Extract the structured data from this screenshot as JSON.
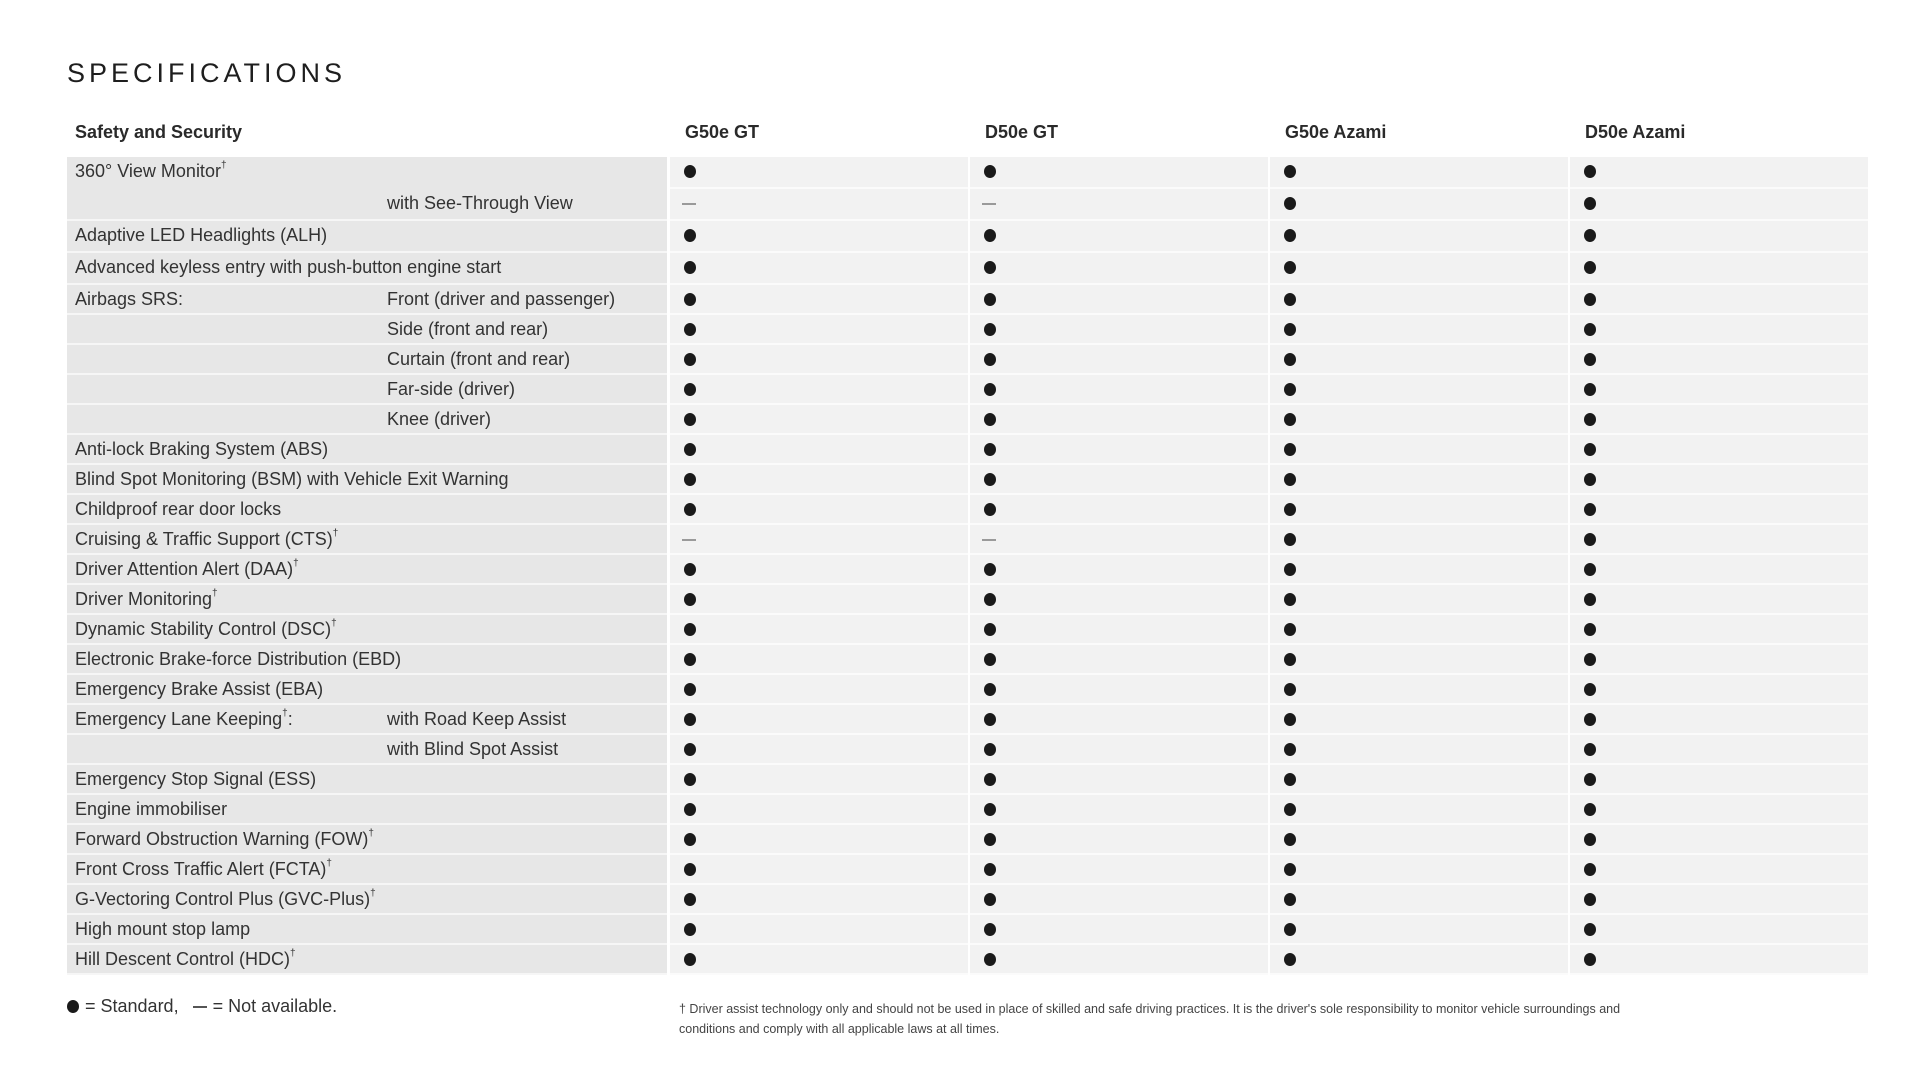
{
  "page": {
    "title": "SPECIFICATIONS"
  },
  "table": {
    "section_header": "Safety and Security",
    "columns": [
      "G50e GT",
      "D50e GT",
      "G50e Azami",
      "D50e Azami"
    ],
    "rows": [
      {
        "label": "360° View Monitor",
        "dagger": true,
        "sub": "",
        "values": [
          "standard",
          "standard",
          "standard",
          "standard"
        ]
      },
      {
        "label": "",
        "dagger": false,
        "sub": "with See-Through View",
        "values": [
          "not_available",
          "not_available",
          "standard",
          "standard"
        ]
      },
      {
        "label": "Adaptive LED Headlights (ALH)",
        "dagger": false,
        "sub": "",
        "values": [
          "standard",
          "standard",
          "standard",
          "standard"
        ]
      },
      {
        "label": "Advanced keyless entry with push-button engine start",
        "dagger": false,
        "sub": "",
        "values": [
          "standard",
          "standard",
          "standard",
          "standard"
        ]
      },
      {
        "label": "Airbags SRS:",
        "dagger": false,
        "sub": "Front (driver and passenger)",
        "values": [
          "standard",
          "standard",
          "standard",
          "standard"
        ]
      },
      {
        "label": "",
        "dagger": false,
        "sub": "Side (front and rear)",
        "values": [
          "standard",
          "standard",
          "standard",
          "standard"
        ]
      },
      {
        "label": "",
        "dagger": false,
        "sub": "Curtain (front and rear)",
        "values": [
          "standard",
          "standard",
          "standard",
          "standard"
        ]
      },
      {
        "label": "",
        "dagger": false,
        "sub": "Far-side (driver)",
        "values": [
          "standard",
          "standard",
          "standard",
          "standard"
        ]
      },
      {
        "label": "",
        "dagger": false,
        "sub": "Knee (driver)",
        "values": [
          "standard",
          "standard",
          "standard",
          "standard"
        ]
      },
      {
        "label": "Anti-lock Braking System (ABS)",
        "dagger": false,
        "sub": "",
        "values": [
          "standard",
          "standard",
          "standard",
          "standard"
        ]
      },
      {
        "label": "Blind Spot Monitoring (BSM) with Vehicle Exit Warning",
        "dagger": false,
        "sub": "",
        "values": [
          "standard",
          "standard",
          "standard",
          "standard"
        ]
      },
      {
        "label": "Childproof rear door locks",
        "dagger": false,
        "sub": "",
        "values": [
          "standard",
          "standard",
          "standard",
          "standard"
        ]
      },
      {
        "label": "Cruising & Traffic Support (CTS)",
        "dagger": true,
        "sub": "",
        "values": [
          "not_available",
          "not_available",
          "standard",
          "standard"
        ]
      },
      {
        "label": "Driver Attention Alert (DAA)",
        "dagger": true,
        "sub": "",
        "values": [
          "standard",
          "standard",
          "standard",
          "standard"
        ]
      },
      {
        "label": "Driver Monitoring",
        "dagger": true,
        "sub": "",
        "values": [
          "standard",
          "standard",
          "standard",
          "standard"
        ]
      },
      {
        "label": "Dynamic Stability Control (DSC)",
        "dagger": true,
        "sub": "",
        "values": [
          "standard",
          "standard",
          "standard",
          "standard"
        ]
      },
      {
        "label": "Electronic Brake-force Distribution (EBD)",
        "dagger": false,
        "sub": "",
        "values": [
          "standard",
          "standard",
          "standard",
          "standard"
        ]
      },
      {
        "label": "Emergency Brake Assist (EBA)",
        "dagger": false,
        "sub": "",
        "values": [
          "standard",
          "standard",
          "standard",
          "standard"
        ]
      },
      {
        "label": "Emergency Lane Keeping:",
        "dagger": true,
        "sub": "with Road Keep Assist",
        "values": [
          "standard",
          "standard",
          "standard",
          "standard"
        ]
      },
      {
        "label": "",
        "dagger": false,
        "sub": "with Blind Spot Assist",
        "values": [
          "standard",
          "standard",
          "standard",
          "standard"
        ]
      },
      {
        "label": "Emergency Stop Signal (ESS)",
        "dagger": false,
        "sub": "",
        "values": [
          "standard",
          "standard",
          "standard",
          "standard"
        ]
      },
      {
        "label": "Engine immobiliser",
        "dagger": false,
        "sub": "",
        "values": [
          "standard",
          "standard",
          "standard",
          "standard"
        ]
      },
      {
        "label": "Forward Obstruction Warning (FOW)",
        "dagger": true,
        "sub": "",
        "values": [
          "standard",
          "standard",
          "standard",
          "standard"
        ]
      },
      {
        "label": "Front Cross Traffic Alert (FCTA)",
        "dagger": true,
        "sub": "",
        "values": [
          "standard",
          "standard",
          "standard",
          "standard"
        ]
      },
      {
        "label": "G-Vectoring Control Plus (GVC-Plus)",
        "dagger": true,
        "sub": "",
        "values": [
          "standard",
          "standard",
          "standard",
          "standard"
        ]
      },
      {
        "label": "High mount stop lamp",
        "dagger": false,
        "sub": "",
        "values": [
          "standard",
          "standard",
          "standard",
          "standard"
        ]
      },
      {
        "label": "Hill Descent Control (HDC)",
        "dagger": true,
        "sub": "",
        "values": [
          "standard",
          "standard",
          "standard",
          "standard"
        ]
      }
    ]
  },
  "legend": {
    "standard_text": "= Standard,",
    "not_available_text": "= Not available."
  },
  "footnote": {
    "dagger_symbol": "†",
    "text": "† Driver assist technology only and should not be used in place of skilled and safe driving practices. It is the driver's sole responsibility to monitor vehicle surroundings and conditions and comply with all applicable laws at all times."
  }
}
